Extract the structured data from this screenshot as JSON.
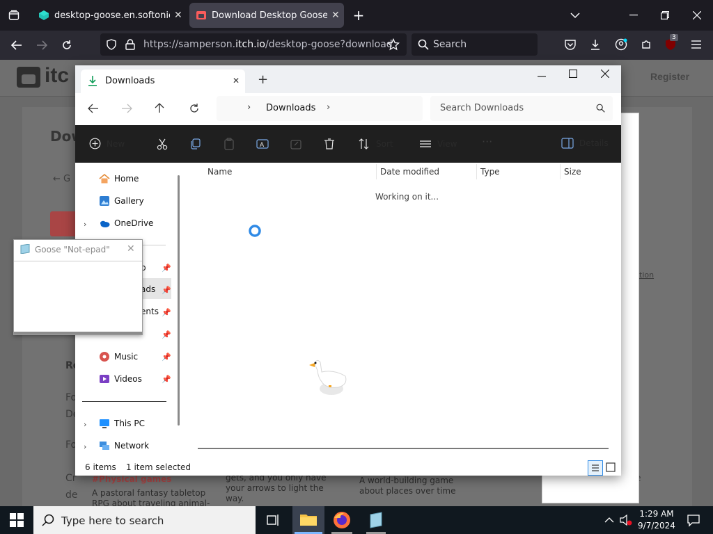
{
  "browser": {
    "tabs": [
      {
        "title": "desktop-goose.en.softonic.com",
        "active": false,
        "favicon": "softonic-icon"
      },
      {
        "title": "Download Desktop Goose by samperson",
        "active": true,
        "favicon": "itchio-icon"
      }
    ],
    "url_prefix": "https://samperson.",
    "url_domain": "itch.io",
    "url_path": "/desktop-goose?download",
    "search_placeholder": "Search",
    "extension_badge": "3"
  },
  "page_behind": {
    "logo_text": "itc",
    "register": "Register",
    "fragments": {
      "dow": "Dow",
      "back": "← G",
      "re": "Re",
      "fo1": "Fo",
      "de1": "De",
      "fo2": "Fo",
      "cr": "Cr",
      "de2": "de",
      "tion": "tion",
      "e": "e"
    },
    "card1_tag": "#Physical games",
    "card1_text": "A pastoral fantasy tabletop RPG about traveling animal-folk and the",
    "card2_text": "gets, and you only have your arrows to light the way.",
    "card3_text": "A world-building game about places over time"
  },
  "explorer": {
    "tab_title": "Downloads",
    "breadcrumb": "Downloads",
    "search_placeholder": "Search Downloads",
    "commands": {
      "new": "New",
      "sort": "Sort",
      "view": "View",
      "details": "Details"
    },
    "nav": {
      "home": "Home",
      "gallery": "Gallery",
      "onedrive": "OneDrive",
      "desktop": "p",
      "downloads": "ads",
      "documents": "ents",
      "music": "Music",
      "videos": "Videos",
      "thispc": "This PC",
      "network": "Network"
    },
    "columns": [
      "Name",
      "Date modified",
      "Type",
      "Size"
    ],
    "working": "Working on it...",
    "status_items": "6 items",
    "status_selected": "1 item selected"
  },
  "notepad": {
    "title": "Goose \"Not-epad\""
  },
  "taskbar": {
    "search_placeholder": "Type here to search",
    "time": "1:29 AM",
    "date": "9/7/2024"
  },
  "colors": {
    "accent": "#0078d4",
    "itch_red": "#fa5c5c"
  }
}
